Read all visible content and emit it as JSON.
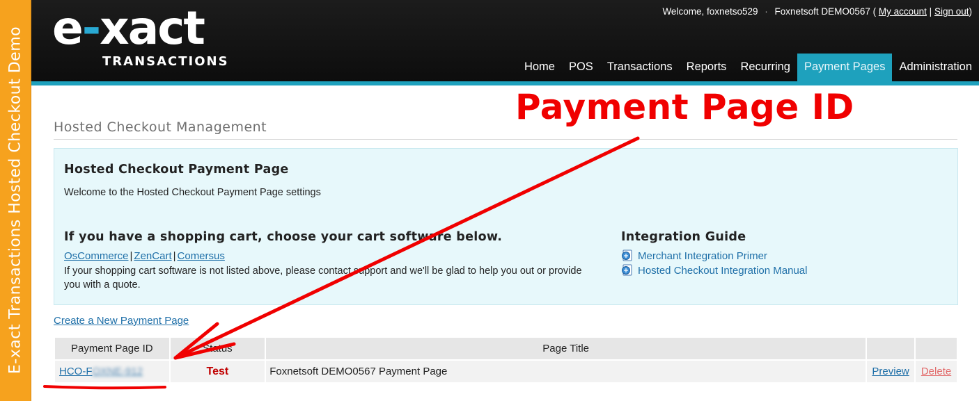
{
  "side_banner": {
    "text": "E-xact Transactions Hosted Checkout Demo"
  },
  "header": {
    "logo": {
      "brand_prefix": "e",
      "brand_dash": "-",
      "brand_suffix": "xact",
      "sub": "TRANSACTIONS"
    },
    "user_bar": {
      "welcome": "Welcome, foxnetso529",
      "account_name": "Foxnetsoft DEMO0567 (",
      "my_account": "My account",
      "sign_out": "Sign out",
      "close_paren": ")"
    },
    "nav": [
      {
        "label": "Home"
      },
      {
        "label": "POS"
      },
      {
        "label": "Transactions"
      },
      {
        "label": "Reports"
      },
      {
        "label": "Recurring"
      },
      {
        "label": "Payment Pages",
        "active": true
      },
      {
        "label": "Administration"
      }
    ],
    "colors": {
      "accent": "#1ea1bd",
      "banner": "#f6a21e"
    }
  },
  "main": {
    "page_title": "Hosted Checkout Management",
    "info_box": {
      "heading": "Hosted Checkout Payment Page",
      "welcome": "Welcome to the Hosted Checkout Payment Page settings",
      "cart_heading": "If you have a shopping cart, choose your cart software below.",
      "cart_links": [
        "OsCommerce",
        "ZenCart",
        "Comersus"
      ],
      "cart_note": "If your shopping cart software is not listed above, please contact support and we'll be glad to help you out or provide you with a quote.",
      "guide_heading": "Integration Guide",
      "guide_links": [
        "Merchant Integration Primer",
        "Hosted Checkout Integration Manual"
      ]
    },
    "create_link": "Create a New Payment Page",
    "table": {
      "columns": [
        "Payment Page ID",
        "Status",
        "Page Title",
        "",
        ""
      ],
      "rows": [
        {
          "id_visible": "HCO-F",
          "id_blurred": "OXNE-912",
          "status": "Test",
          "title": "Foxnetsoft DEMO0567 Payment Page",
          "preview": "Preview",
          "delete": "Delete"
        }
      ]
    }
  },
  "annotation": {
    "label": "Payment Page ID",
    "color": "#f00000"
  }
}
